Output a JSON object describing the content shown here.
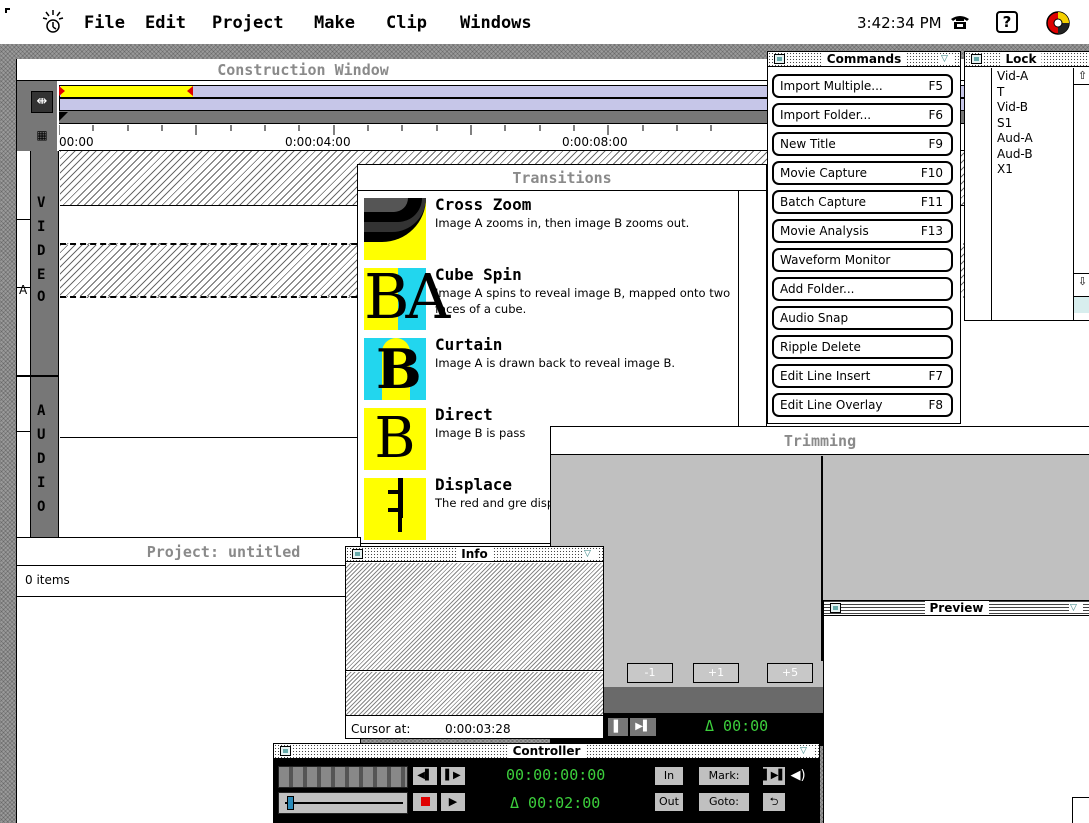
{
  "menubar": {
    "items": [
      "File",
      "Edit",
      "Project",
      "Make",
      "Clip",
      "Windows"
    ],
    "clock": "3:42:34 PM",
    "help_glyph": "?",
    "icons": [
      "app-icon",
      "phone-icon",
      "help-icon",
      "color-wheel-icon"
    ]
  },
  "construction": {
    "title": "Construction Window",
    "timecodes": [
      "00:00",
      "0:00:04:00",
      "0:00:08:00"
    ],
    "video_track_letters": [
      "V",
      "I",
      "D",
      "E",
      "O"
    ],
    "video_track_suffix": "A",
    "audio_track_letters": [
      "A",
      "U",
      "D",
      "I",
      "O"
    ]
  },
  "transitions": {
    "title": "Transitions",
    "items": [
      {
        "name": "Cross Zoom",
        "desc": "Image A zooms in, then image B zooms out.",
        "icon": "cross-zoom-icon"
      },
      {
        "name": "Cube Spin",
        "desc": "Image A spins to reveal image B, mapped onto two faces of a cube.",
        "icon": "cube-spin-icon",
        "glyph": "BA"
      },
      {
        "name": "Curtain",
        "desc": "Image A is drawn back to reveal image B.",
        "icon": "curtain-icon",
        "glyph": "B"
      },
      {
        "name": "Direct",
        "desc": "Image B is pass",
        "icon": "direct-icon",
        "glyph": "B"
      },
      {
        "name": "Displace",
        "desc": "The red and gre displace the pix",
        "icon": "displace-icon"
      }
    ]
  },
  "commands": {
    "title": "Commands",
    "items": [
      {
        "label": "Import Multiple...",
        "key": "F5"
      },
      {
        "label": "Import Folder...",
        "key": "F6"
      },
      {
        "label": "New Title",
        "key": "F9"
      },
      {
        "label": "Movie Capture",
        "key": "F10"
      },
      {
        "label": "Batch Capture",
        "key": "F11"
      },
      {
        "label": "Movie Analysis",
        "key": "F13"
      },
      {
        "label": "Waveform Monitor",
        "key": ""
      },
      {
        "label": "Add Folder...",
        "key": ""
      },
      {
        "label": "Audio Snap",
        "key": ""
      },
      {
        "label": "Ripple Delete",
        "key": ""
      },
      {
        "label": "Edit Line Insert",
        "key": "F7"
      },
      {
        "label": "Edit Line Overlay",
        "key": "F8"
      }
    ]
  },
  "lock": {
    "title": "Lock",
    "tracks": [
      "Vid-A",
      "T",
      "Vid-B",
      "S1",
      "Aud-A",
      "Aud-B",
      "X1"
    ]
  },
  "trimming": {
    "title": "Trimming",
    "buttons": [
      "-1",
      "+1",
      "+5"
    ],
    "timecode": "Δ 00:00"
  },
  "preview": {
    "title": "Preview"
  },
  "project": {
    "title": "Project: untitled",
    "count": "0 items"
  },
  "info": {
    "title": "Info",
    "cursor_label": "Cursor at:",
    "cursor_value": "0:00:03:28"
  },
  "controller": {
    "title": "Controller",
    "timecode_top": "00:00:00:00",
    "timecode_bottom": "Δ 00:02:00",
    "in_label": "In",
    "out_label": "Out",
    "mark_label": "Mark:",
    "goto_label": "Goto:"
  },
  "colors": {
    "timeline_yellow": "#ffff00",
    "timeline_lavender": "#c6c6e8",
    "lcd_green": "#3ccf3c",
    "thumb_yellow": "#ffff00",
    "thumb_cyan": "#22d6ee",
    "record_red": "#e00000"
  }
}
